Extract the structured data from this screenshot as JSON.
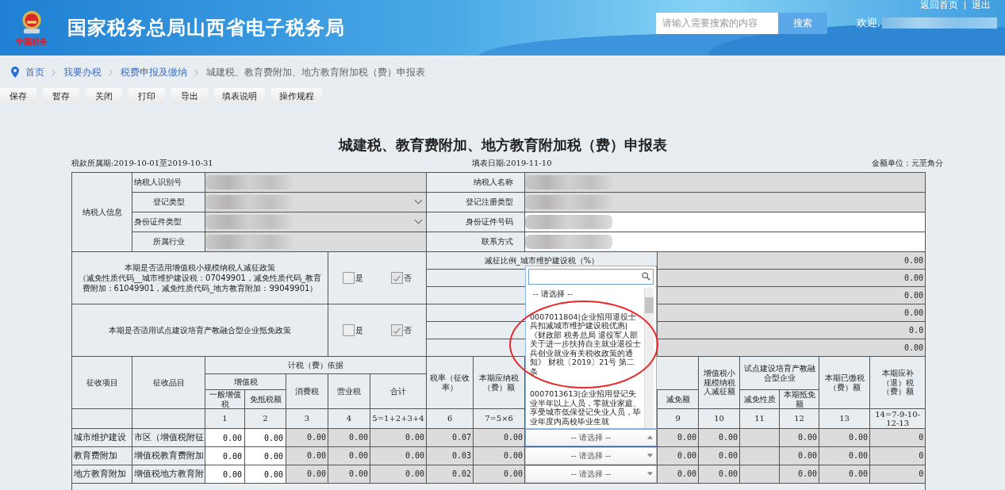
{
  "header": {
    "emblem_caption": "中国税务",
    "site_title": "国家税务总局山西省电子税务局",
    "search": {
      "placeholder": "请输入需要搜索的内容",
      "button": "搜索"
    },
    "welcome": "欢迎,",
    "links": [
      "返回首页",
      "退出"
    ]
  },
  "breadcrumb": [
    {
      "label": "首页",
      "link": true
    },
    {
      "label": "我要办税",
      "link": true
    },
    {
      "label": "税费申报及缴纳",
      "link": true
    },
    {
      "label": "城建税、教育费附加、地方教育附加税（费）申报表",
      "link": false
    }
  ],
  "toolbar": [
    "保存",
    "暂存",
    "关闭",
    "打印",
    "导出",
    "填表说明",
    "操作规程"
  ],
  "form": {
    "title": "城建税、教育费附加、地方教育附加税（费）申报表",
    "period": "税款所属期:2019-10-01至2019-10-31",
    "fill_date": "填表日期:2019-11-10",
    "unit": "金额单位：元至角分"
  },
  "taxpayer": {
    "group_label": "纳税人信息",
    "rows": [
      {
        "left": {
          "label": "纳税人识别号",
          "kind": "text",
          "redacted": true,
          "editable": false
        },
        "right": {
          "label": "纳税人名称",
          "redacted": true,
          "editable": false
        }
      },
      {
        "left": {
          "label": "登记类型",
          "kind": "select",
          "redacted": true,
          "editable": false
        },
        "right": {
          "label": "登记注册类型",
          "redacted": true,
          "editable": false
        }
      },
      {
        "left": {
          "label": "身份证件类型",
          "kind": "select",
          "redacted": true,
          "editable": false
        },
        "right": {
          "label": "身份证件号码",
          "redacted": true,
          "editable": true
        }
      },
      {
        "left": {
          "label": "所属行业",
          "kind": "text",
          "redacted": true,
          "editable": false
        },
        "right": {
          "label": "联系方式",
          "redacted": true,
          "editable": true
        }
      }
    ]
  },
  "policies": [
    {
      "question": "本期是否适用增值税小规模纳税人减征政策",
      "note": "（减免性质代码__城市维护建设税：07049901，减免性质代码_教育费附加：61049901，减免性质代码_地方教育附加：99049901）",
      "options": [
        {
          "label": "是",
          "checked": false
        },
        {
          "label": "否",
          "checked": true
        }
      ],
      "lines": [
        {
          "label": "减征比例_城市维护建设税（%）",
          "value": "0.00"
        },
        {
          "value": "0.00"
        },
        {
          "value": "0.00"
        }
      ]
    },
    {
      "question": "本期是否适用试点建设培育产教融合型企业抵免政策",
      "options": [
        {
          "label": "是",
          "checked": false
        },
        {
          "label": "否",
          "checked": true
        }
      ],
      "lines": [
        {
          "value": "0.00"
        },
        {
          "value": "0.0"
        },
        {
          "value": "0.00"
        }
      ]
    }
  ],
  "table": {
    "header": {
      "project": "征收项目",
      "item": "征收品目",
      "basis": "计税（费）依据",
      "vat": "增值税",
      "general_vat": "一般增值税",
      "exempt_offset": "免抵税额",
      "consumption": "消费税",
      "business": "营业税",
      "total": "合计",
      "rate": "税率（征收率）",
      "payable": "本期应纳税（费）额",
      "reduction_amount": "减免额",
      "small_scale": "增值税小规模纳税人减征额",
      "pilot": "试点建设培育产教融合型企业",
      "pilot_nature": "减免性质",
      "pilot_offset": "本期抵免额",
      "paid": "本期已缴税（费）额",
      "refund": "本期应补（退）税（费）额"
    },
    "column_numbers": [
      "1",
      "2",
      "3",
      "4",
      "5=1+2+3+4",
      "6",
      "7=5×6",
      "9",
      "10",
      "11",
      "12",
      "13",
      "14=7-9-10-12-13"
    ],
    "rows": [
      {
        "project": "城市维护建设",
        "item": "市区（增值税附征",
        "inputs": [
          "0.00",
          "0.00"
        ],
        "values": [
          "0.00",
          "0.00",
          "0.00",
          "0.07",
          "0.00"
        ],
        "reduction_values": [
          "0.00",
          "0.00"
        ],
        "closing_values": [
          "0.00",
          "0.00",
          "0"
        ],
        "reduction": {
          "text": "-- 请选择 --",
          "open": true,
          "options": [
            {
              "text": "-- 请选择 --",
              "circled": false
            },
            {
              "text": "0007011804|企业招用退役士兵扣减城市维护建设税优惠|《财政部 税务总局 退役军人部关于进一步扶持自主就业退役士兵创业就业有关税收政策的通知》 财税〔2019〕21号 第二条",
              "circled": true
            },
            {
              "text": "0007013613|企业招用登记失业半年以上人员，零就业家庭、享受城市低保登记失业人员，毕业年度内高校毕业生就",
              "circled": false
            }
          ]
        }
      },
      {
        "project": "教育费附加",
        "item": "增值税教育费附加",
        "inputs": [
          "0.00",
          "0.00"
        ],
        "values": [
          "0.00",
          "0.00",
          "0.00",
          "0.03",
          "0.00"
        ],
        "reduction_values": [
          "0.00",
          "0.00"
        ],
        "closing_values": [
          "0.00",
          "0.00",
          "0"
        ],
        "reduction": {
          "text": "-- 请选择 --",
          "open": false
        }
      },
      {
        "project": "地方教育附加",
        "item": "增值税地方教育附",
        "inputs": [
          "0.00",
          "0.00"
        ],
        "values": [
          "0.00",
          "0.00",
          "0.00",
          "0.02",
          "0.00"
        ],
        "reduction_values": [
          "0.00",
          "0.00"
        ],
        "closing_values": [
          "0.00",
          "0.00",
          "0"
        ],
        "reduction": {
          "text": "-- 请选择 --",
          "open": false
        }
      }
    ]
  }
}
